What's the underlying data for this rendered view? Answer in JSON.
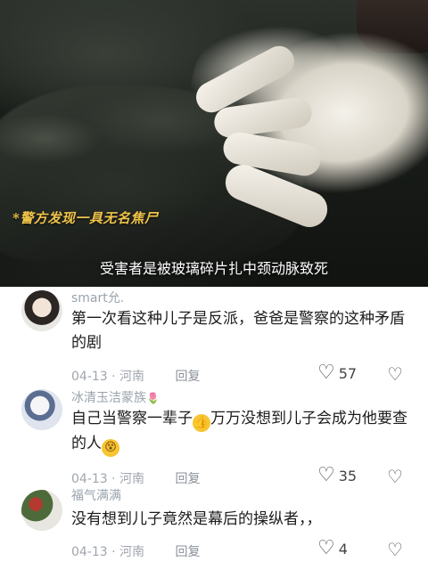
{
  "video": {
    "tag_caption": "*警方发现一具无名焦尸",
    "subtitle": "受害者是被玻璃碎片扎中颈动脉致死"
  },
  "comments": [
    {
      "username": "smart允.",
      "text": "第一次看这种儿子是反派，爸爸是警察的这种矛盾的剧",
      "date": "04-13",
      "location": "河南",
      "reply_label": "回复",
      "likes": "57"
    },
    {
      "username": "冰清玉洁蒙族",
      "text_before": "自己当警察一辈子",
      "text_mid": "万万没想到儿子会成为他要查的人",
      "date": "04-13",
      "location": "河南",
      "reply_label": "回复",
      "likes": "35"
    },
    {
      "username": "福气满满",
      "text": "没有想到儿子竟然是幕后的操纵者，，",
      "date": "04-13",
      "location": "河南",
      "reply_label": "回复",
      "likes": "4"
    }
  ],
  "icons": {
    "like": "heart-outline-icon",
    "dislike": "broken-heart-icon",
    "thumb": "thumbs-up-emoji",
    "face": "dizzy-face-emoji"
  }
}
